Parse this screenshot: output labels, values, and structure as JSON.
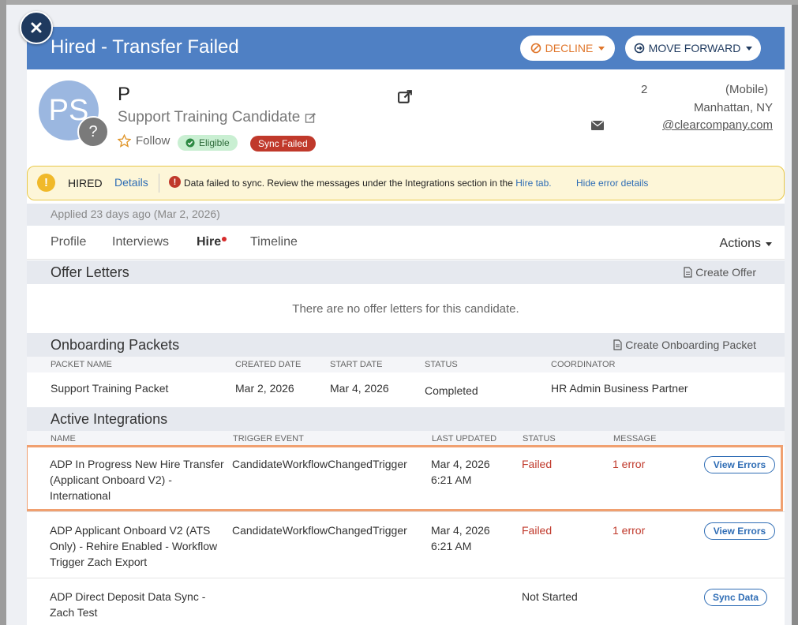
{
  "header": {
    "title": "Hired - Transfer Failed",
    "decline_label": "DECLINE",
    "forward_label": "MOVE FORWARD"
  },
  "candidate": {
    "initials": "PS",
    "name": "P",
    "role": "Support Training Candidate",
    "follow_label": "Follow",
    "eligible_label": "Eligible",
    "sync_label": "Sync Failed",
    "phone": "2",
    "phone_type": "(Mobile)",
    "location": "Manhattan, NY",
    "email": "@clearcompany.com"
  },
  "alert": {
    "status": "HIRED",
    "details_label": "Details",
    "message": "Data failed to sync. Review the messages under the Integrations section in the ",
    "message_link": "Hire tab.",
    "hide_label": "Hide error details"
  },
  "applied_text": "Applied 23 days ago (Mar 2, 2026)",
  "tabs": [
    "Profile",
    "Interviews",
    "Hire",
    "Timeline"
  ],
  "actions_label": "Actions",
  "offer_letters": {
    "title": "Offer Letters",
    "action": "Create Offer",
    "empty": "There are no offer letters for this candidate."
  },
  "onboarding": {
    "title": "Onboarding Packets",
    "action": "Create Onboarding Packet",
    "columns": [
      "PACKET NAME",
      "CREATED DATE",
      "START DATE",
      "STATUS",
      "COORDINATOR"
    ],
    "rows": [
      {
        "name": "Support Training Packet",
        "created": "Mar 2, 2026",
        "start": "Mar 4, 2026",
        "status": "Completed",
        "coordinator": "HR Admin Business Partner"
      }
    ]
  },
  "integrations": {
    "title": "Active Integrations",
    "columns": [
      "NAME",
      "TRIGGER EVENT",
      "LAST UPDATED",
      "STATUS",
      "MESSAGE"
    ],
    "rows": [
      {
        "name": "ADP In Progress New Hire Transfer (Applicant Onboard V2) - International",
        "trigger": "CandidateWorkflowChangedTrigger",
        "date": "Mar 4, 2026",
        "time": "6:21 AM",
        "status": "Failed",
        "message": "1 error",
        "button": "View Errors"
      },
      {
        "name": "ADP Applicant Onboard V2 (ATS Only) - Rehire Enabled - Workflow Trigger Zach Export",
        "trigger": "CandidateWorkflowChangedTrigger",
        "date": "Mar 4, 2026",
        "time": "6:21 AM",
        "status": "Failed",
        "message": "1 error",
        "button": "View Errors"
      },
      {
        "name": "ADP Direct Deposit Data Sync - Zach Test",
        "trigger": "",
        "date": "",
        "time": "",
        "status": "Not Started",
        "message": "",
        "button": "Sync Data"
      }
    ]
  },
  "colors": {
    "header_blue": "#4f80c4",
    "failed_red": "#c0392b",
    "link_blue": "#2f6db5",
    "highlight_orange": "#f0a070"
  }
}
